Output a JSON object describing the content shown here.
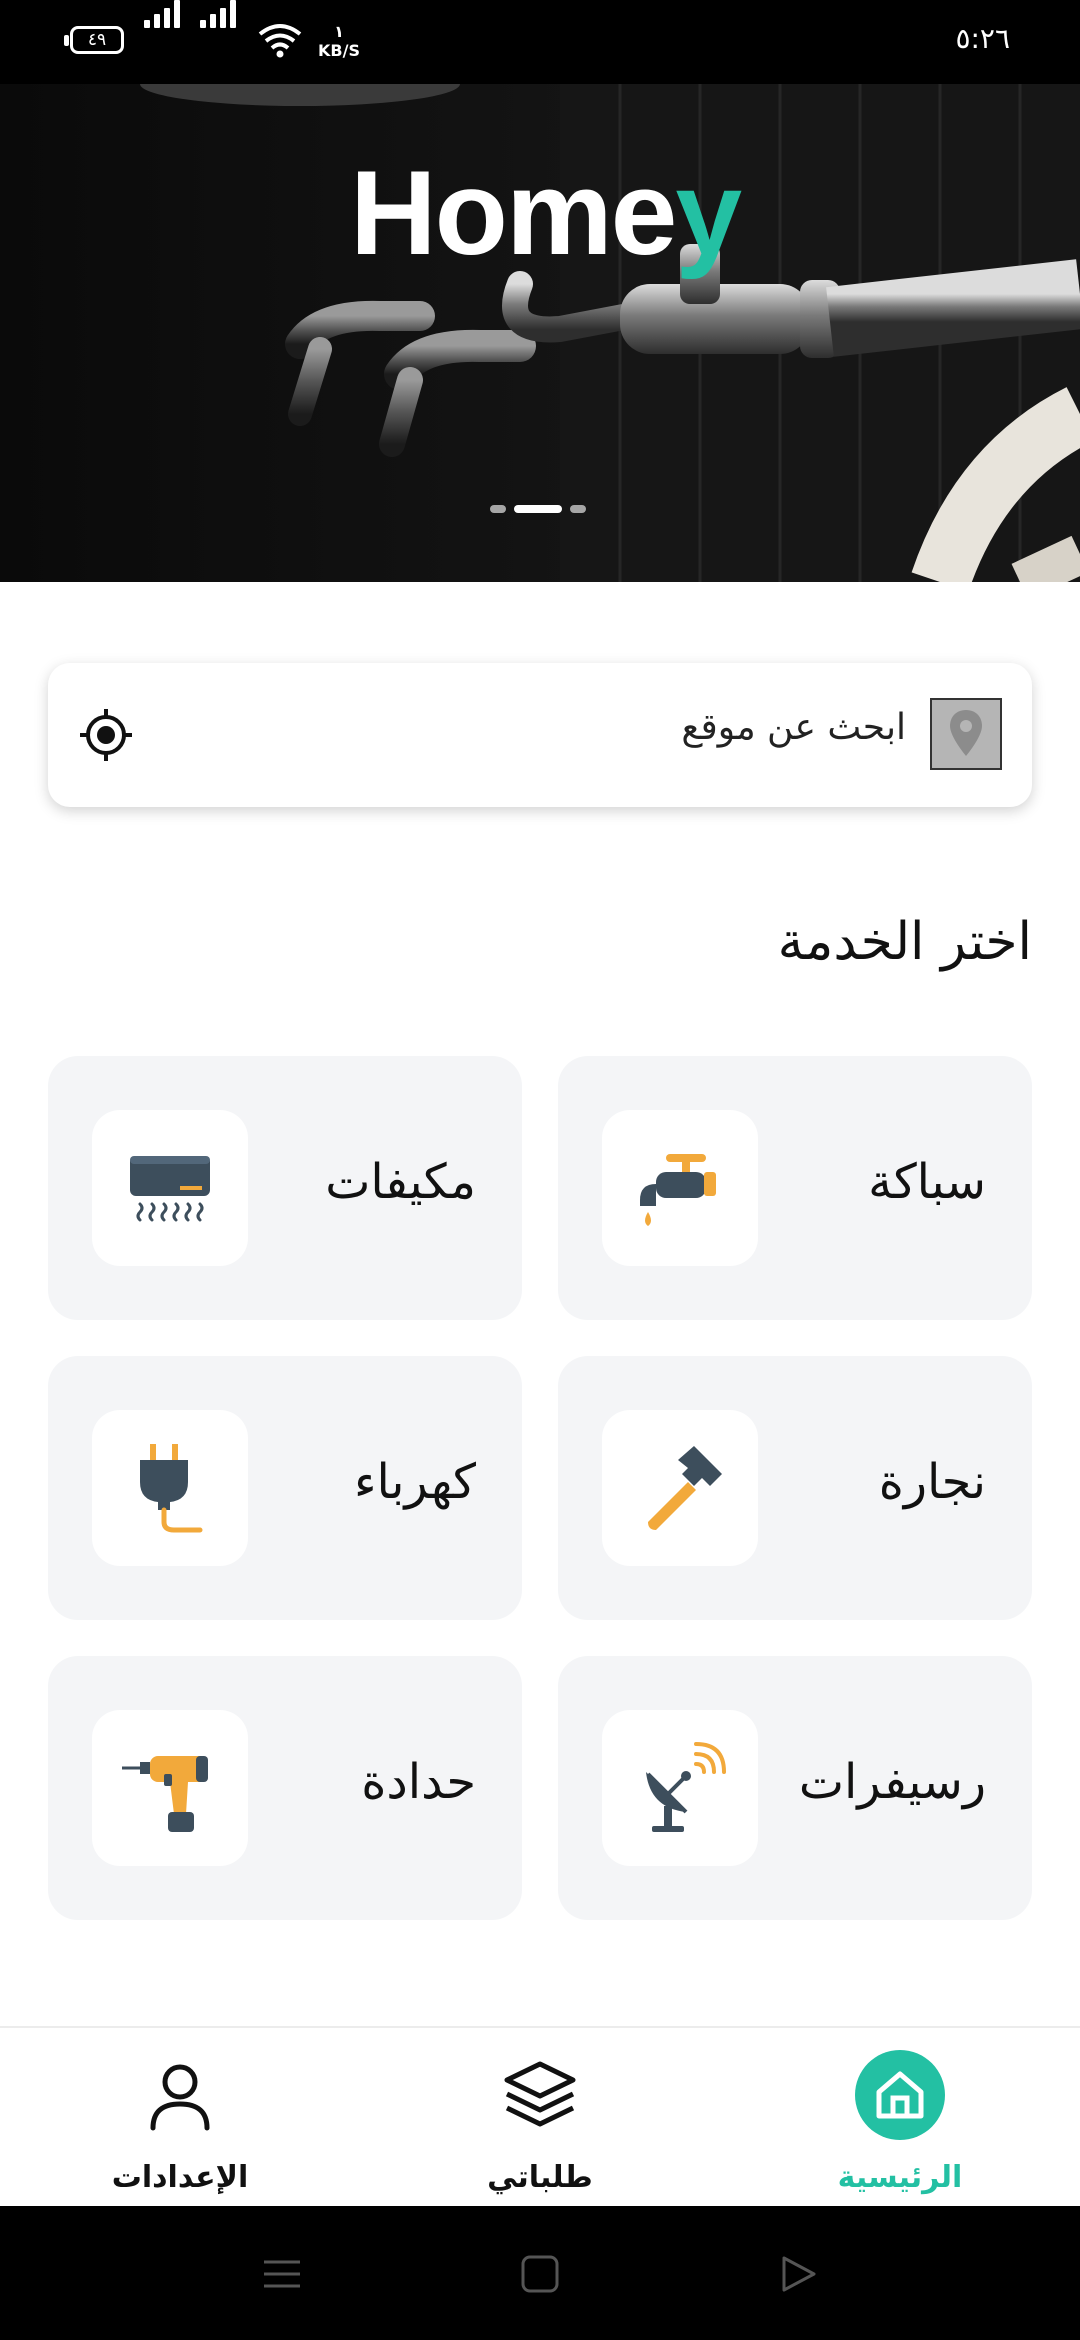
{
  "status_bar": {
    "battery": "٤٩",
    "speed_value": "١",
    "speed_unit": "KB/S",
    "time": "٥:٢٦"
  },
  "hero": {
    "brand_prefix": "Home",
    "brand_suffix": "y",
    "slides_count": 3,
    "active_slide": 2
  },
  "search": {
    "placeholder": "ابحث عن موقع",
    "pin_icon": "map-pin-icon",
    "locate_icon": "gps-target-icon"
  },
  "services": {
    "title": "اختر الخدمة",
    "items": [
      {
        "label": "سباكة",
        "icon": "faucet-icon"
      },
      {
        "label": "مكيفات",
        "icon": "air-conditioner-icon"
      },
      {
        "label": "نجارة",
        "icon": "hammer-icon"
      },
      {
        "label": "كهرباء",
        "icon": "plug-icon"
      },
      {
        "label": "رسيفرات",
        "icon": "satellite-dish-icon"
      },
      {
        "label": "حدادة",
        "icon": "drill-icon"
      }
    ]
  },
  "bottom_nav": {
    "home": "الرئيسية",
    "orders": "طلباتي",
    "settings": "الإعدادات"
  },
  "colors": {
    "accent": "#23c0a3",
    "card_bg": "#f4f5f7",
    "icon_dark": "#3d4e5c",
    "icon_orange": "#f2a93b"
  }
}
